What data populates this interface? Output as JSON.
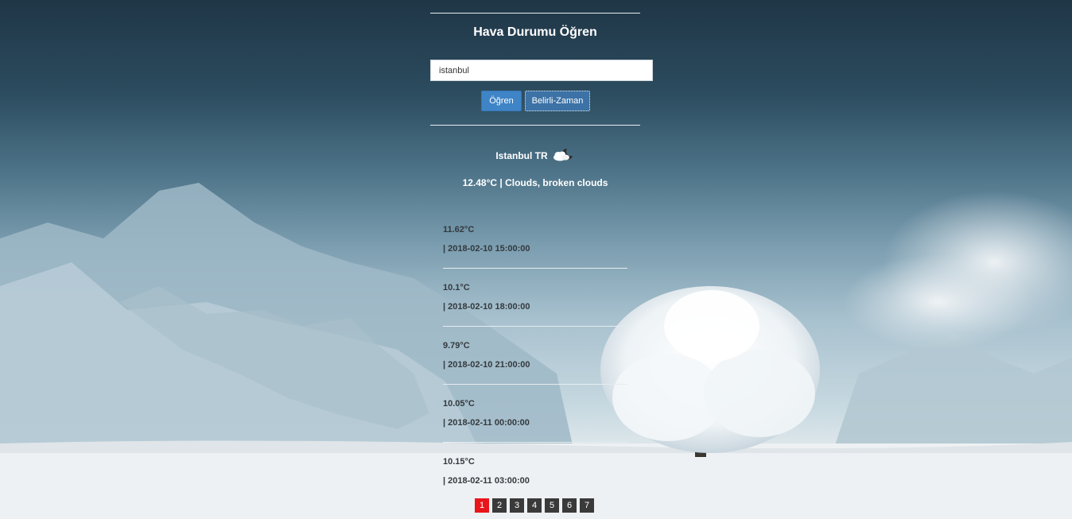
{
  "app": {
    "title": "Hava Durumu Öğren"
  },
  "search": {
    "value": "istanbul"
  },
  "buttons": {
    "learn_label": "Öğren",
    "specific_time_label": "Belirli-Zaman"
  },
  "current": {
    "city": "Istanbul TR",
    "weather_icon": "cloud-moon-icon",
    "summary": "12.48°C | Clouds, broken clouds"
  },
  "forecast": [
    {
      "temp": "11.62°C",
      "time": "| 2018-02-10 15:00:00"
    },
    {
      "temp": "10.1°C",
      "time": "| 2018-02-10 18:00:00"
    },
    {
      "temp": "9.79°C",
      "time": "| 2018-02-10 21:00:00"
    },
    {
      "temp": "10.05°C",
      "time": "| 2018-02-11 00:00:00"
    },
    {
      "temp": "10.15°C",
      "time": "| 2018-02-11 03:00:00"
    }
  ],
  "pagination": {
    "pages": [
      "1",
      "2",
      "3",
      "4",
      "5",
      "6",
      "7"
    ],
    "active": "1"
  },
  "colors": {
    "primary_button": "#3e84c6",
    "active_page": "#e8161b",
    "page": "#3a3a3a"
  }
}
